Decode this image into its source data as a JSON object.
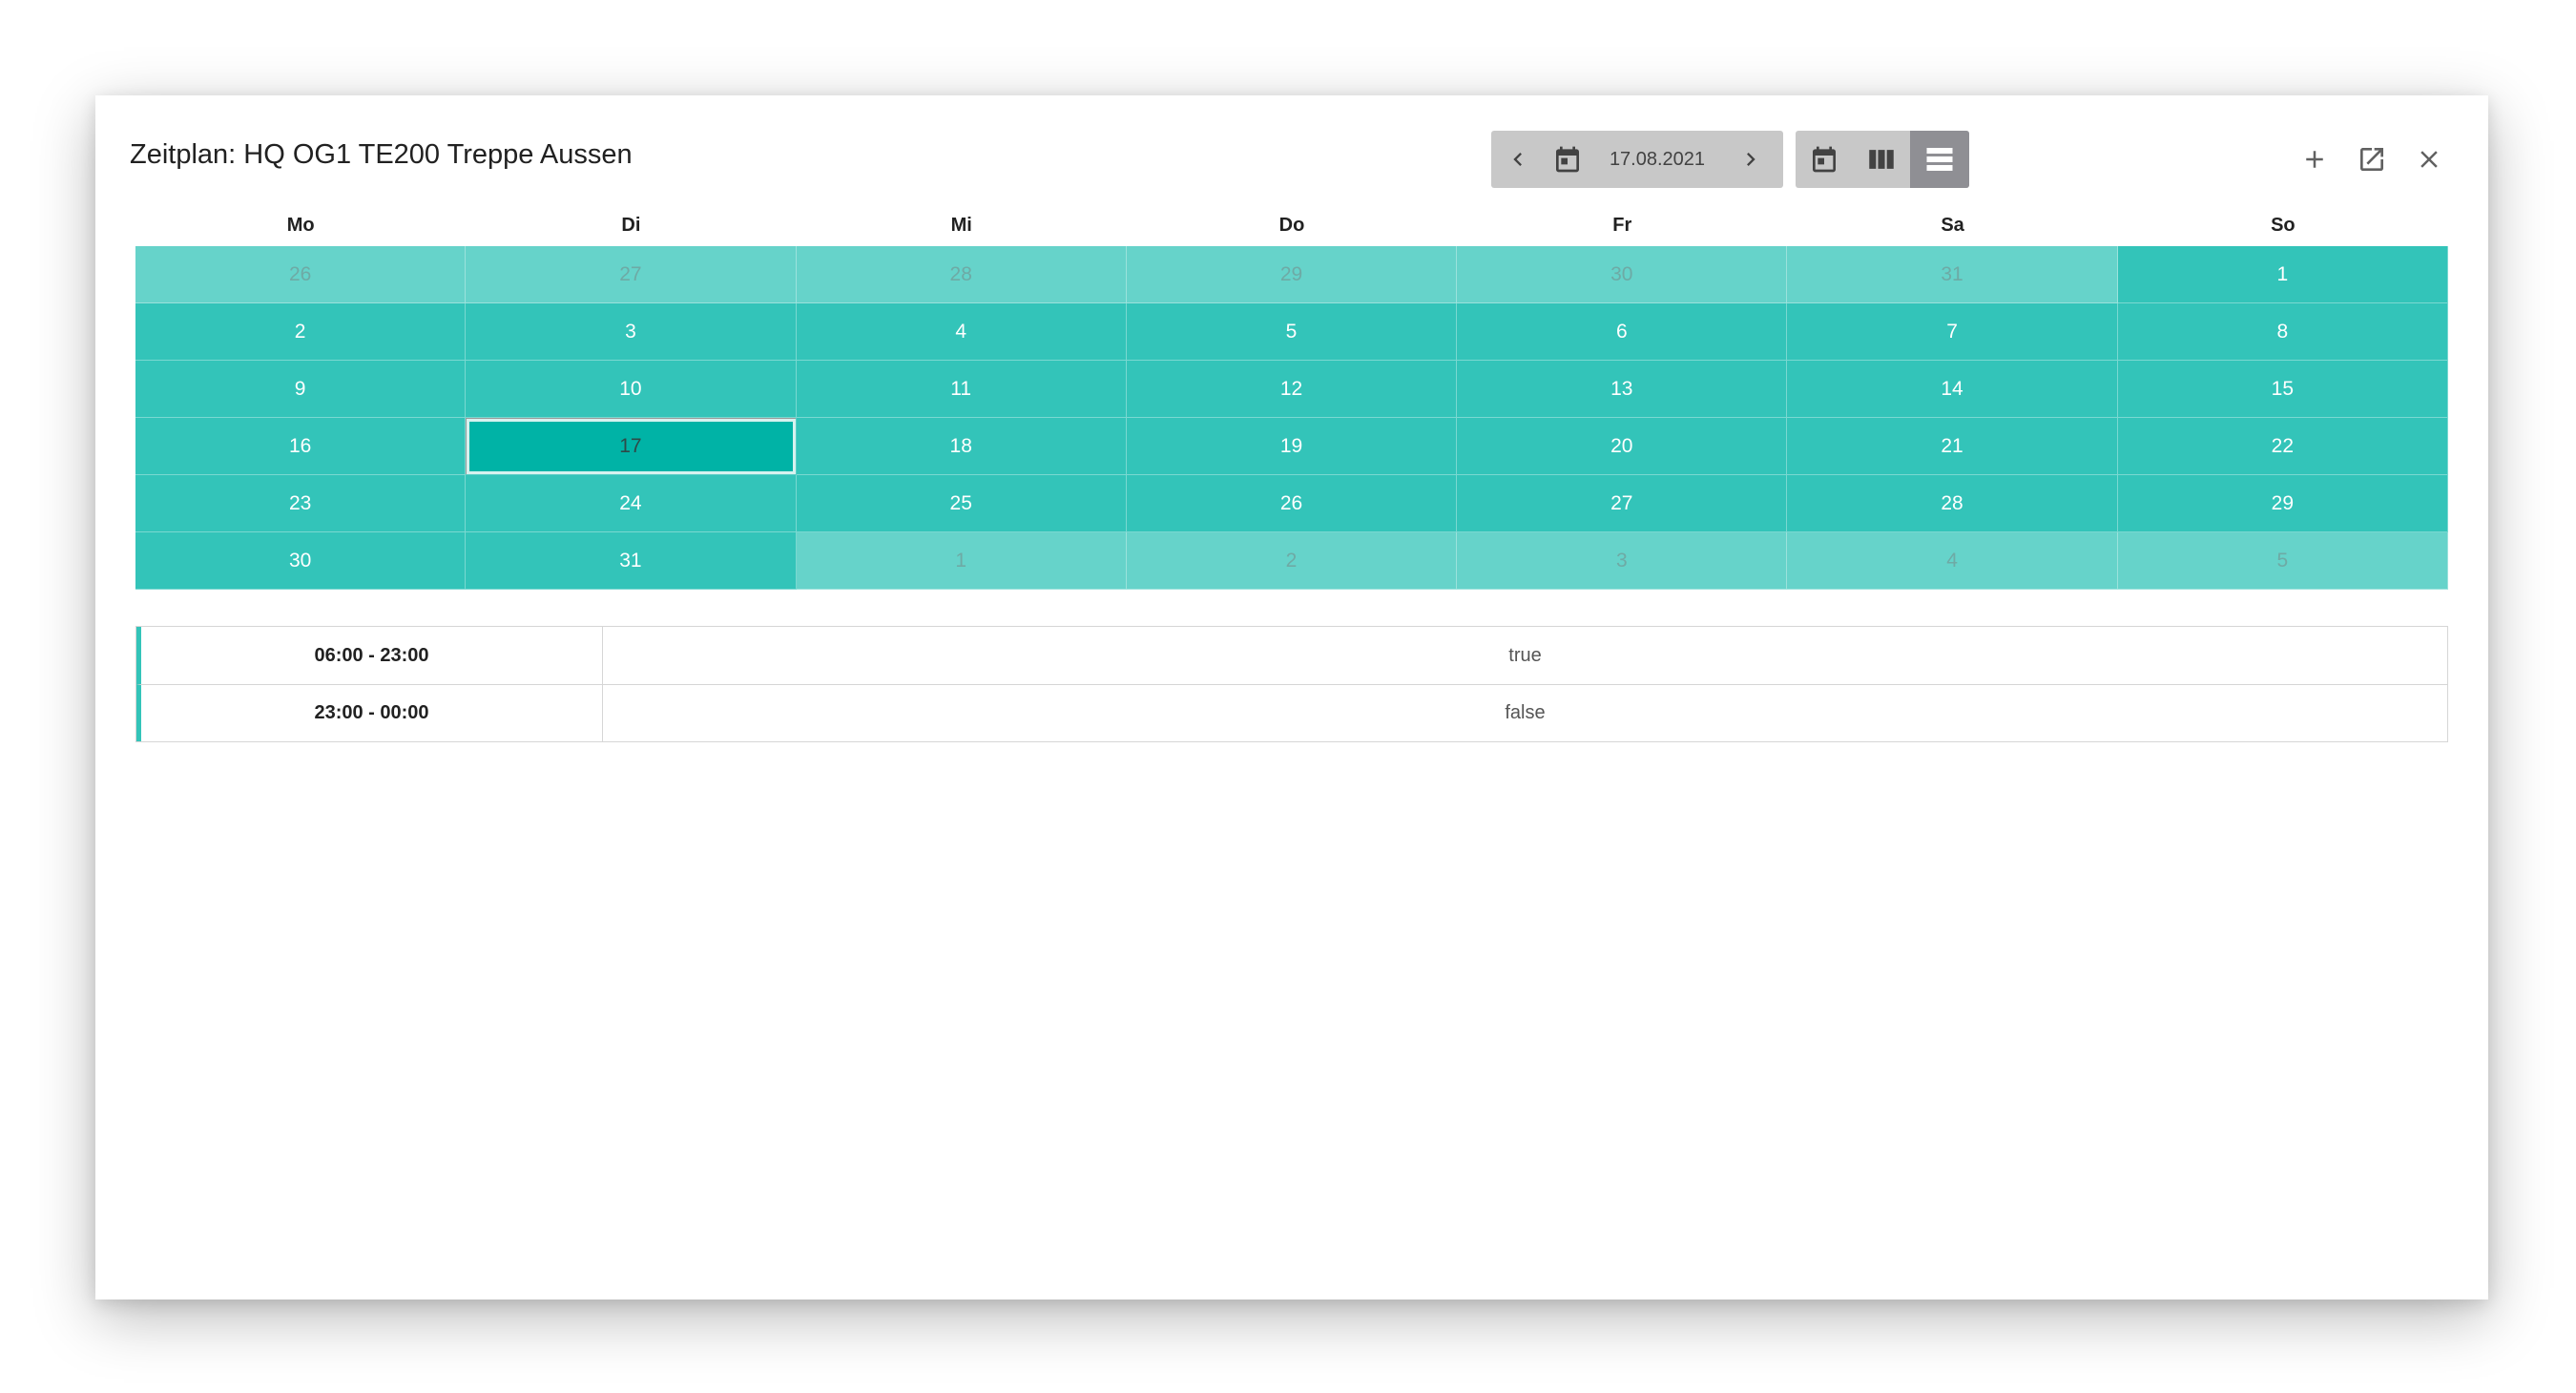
{
  "dialog": {
    "title": "Zeitplan: HQ OG1 TE200 Treppe Aussen"
  },
  "toolbar": {
    "date": "17.08.2021",
    "icons": {
      "prev": "chevron-left-icon",
      "calendar": "calendar-icon",
      "next": "chevron-right-icon",
      "view_day": "calendar-day-icon",
      "view_week": "view-week-icon",
      "view_month": "view-list-icon",
      "add": "plus-icon",
      "open": "open-in-new-icon",
      "close": "close-icon"
    },
    "active_view": "view_month"
  },
  "calendar": {
    "weekdays": [
      "Mo",
      "Di",
      "Mi",
      "Do",
      "Fr",
      "Sa",
      "So"
    ],
    "weeks": [
      [
        {
          "d": "26",
          "o": true
        },
        {
          "d": "27",
          "o": true
        },
        {
          "d": "28",
          "o": true
        },
        {
          "d": "29",
          "o": true
        },
        {
          "d": "30",
          "o": true
        },
        {
          "d": "31",
          "o": true
        },
        {
          "d": "1",
          "o": false
        }
      ],
      [
        {
          "d": "2",
          "o": false
        },
        {
          "d": "3",
          "o": false
        },
        {
          "d": "4",
          "o": false
        },
        {
          "d": "5",
          "o": false
        },
        {
          "d": "6",
          "o": false
        },
        {
          "d": "7",
          "o": false
        },
        {
          "d": "8",
          "o": false
        }
      ],
      [
        {
          "d": "9",
          "o": false
        },
        {
          "d": "10",
          "o": false
        },
        {
          "d": "11",
          "o": false
        },
        {
          "d": "12",
          "o": false
        },
        {
          "d": "13",
          "o": false
        },
        {
          "d": "14",
          "o": false
        },
        {
          "d": "15",
          "o": false
        }
      ],
      [
        {
          "d": "16",
          "o": false
        },
        {
          "d": "17",
          "o": false,
          "selected": true
        },
        {
          "d": "18",
          "o": false
        },
        {
          "d": "19",
          "o": false
        },
        {
          "d": "20",
          "o": false
        },
        {
          "d": "21",
          "o": false
        },
        {
          "d": "22",
          "o": false
        }
      ],
      [
        {
          "d": "23",
          "o": false
        },
        {
          "d": "24",
          "o": false
        },
        {
          "d": "25",
          "o": false
        },
        {
          "d": "26",
          "o": false
        },
        {
          "d": "27",
          "o": false
        },
        {
          "d": "28",
          "o": false
        },
        {
          "d": "29",
          "o": false
        }
      ],
      [
        {
          "d": "30",
          "o": false
        },
        {
          "d": "31",
          "o": false
        },
        {
          "d": "1",
          "o": true
        },
        {
          "d": "2",
          "o": true
        },
        {
          "d": "3",
          "o": true
        },
        {
          "d": "4",
          "o": true
        },
        {
          "d": "5",
          "o": true
        }
      ]
    ],
    "colors": {
      "in_month": "#33c4b9",
      "outside_month": "#66d3ca",
      "selected": "#00b3a6"
    }
  },
  "schedule": {
    "rows": [
      {
        "time": "06:00 - 23:00",
        "value": "true"
      },
      {
        "time": "23:00 - 00:00",
        "value": "false"
      }
    ]
  }
}
